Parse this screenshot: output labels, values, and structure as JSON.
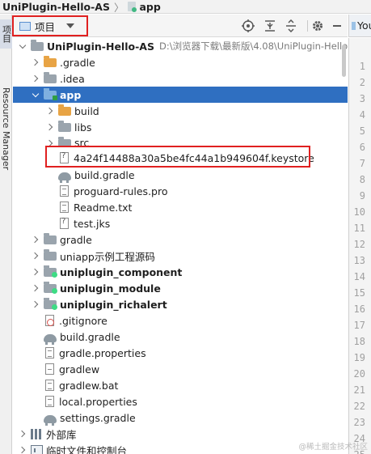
{
  "title_bar": {
    "project": "UniPlugin-Hello-AS",
    "separator": "〉",
    "module": "app"
  },
  "left_strip": {
    "project_tab": "项目",
    "resource_manager_tab": "Resource Manager"
  },
  "toolbar": {
    "view_mode": "项目",
    "icons": [
      "crosshair-icon",
      "collapse-all-icon",
      "expand-all-icon",
      "gear-icon",
      "minimize-icon"
    ]
  },
  "editor": {
    "tab_label": "You",
    "line_numbers": [
      "1",
      "2",
      "3",
      "4",
      "5",
      "6",
      "7",
      "8",
      "9",
      "10",
      "11",
      "12",
      "13",
      "14",
      "15",
      "16",
      "17",
      "18",
      "19",
      "20",
      "21",
      "22",
      "23",
      "24",
      "25"
    ]
  },
  "tree": {
    "root": {
      "name": "UniPlugin-Hello-AS",
      "path": "D:\\浏览器下载\\最新版\\4.08\\UniPlugin-Hello-AS"
    },
    "items": [
      {
        "name": ".gradle"
      },
      {
        "name": ".idea"
      },
      {
        "name": "app"
      },
      {
        "name": "build"
      },
      {
        "name": "libs"
      },
      {
        "name": "src"
      },
      {
        "name": "4a24f14488a30a5be4fc44a1b949604f.keystore"
      },
      {
        "name": "build.gradle"
      },
      {
        "name": "proguard-rules.pro"
      },
      {
        "name": "Readme.txt"
      },
      {
        "name": "test.jks"
      },
      {
        "name": "gradle"
      },
      {
        "name": "uniapp示例工程源码"
      },
      {
        "name": "uniplugin_component"
      },
      {
        "name": "uniplugin_module"
      },
      {
        "name": "uniplugin_richalert"
      },
      {
        "name": ".gitignore"
      },
      {
        "name": "build.gradle"
      },
      {
        "name": "gradle.properties"
      },
      {
        "name": "gradlew"
      },
      {
        "name": "gradlew.bat"
      },
      {
        "name": "local.properties"
      },
      {
        "name": "settings.gradle"
      },
      {
        "name": "外部库"
      },
      {
        "name": "临时文件和控制台"
      }
    ]
  },
  "watermark": "@稀土掘金技术社区"
}
